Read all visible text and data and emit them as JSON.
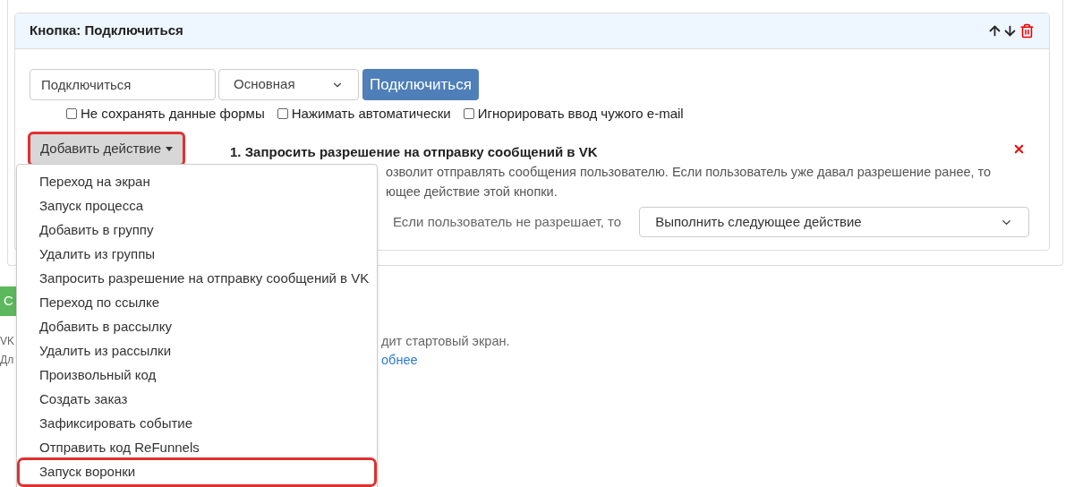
{
  "panel": {
    "title": "Кнопка: Подключиться",
    "button_text_field": {
      "value": "Подключиться"
    },
    "style_select": {
      "value": "Основная"
    },
    "preview_button": "Подключиться",
    "options": [
      {
        "label": "Не сохранять данные формы",
        "checked": false
      },
      {
        "label": "Нажимать автоматически",
        "checked": false
      },
      {
        "label": "Игнорировать ввод чужого e-mail",
        "checked": false
      }
    ],
    "add_action": {
      "label": "Добавить действие",
      "highlighted": true
    },
    "action": {
      "title": "1. Запросить разрешение на отправку сообщений в VK",
      "description_lines": [
        "озволит отправлять сообщения пользователю. Если пользователь уже давал разрешение ранее, то",
        "ющее действие этой кнопки."
      ],
      "deny_label": "Если пользователь не разрешает, то",
      "deny_select": {
        "value": "Выполнить следующее действие"
      }
    }
  },
  "below": {
    "green_button": "С",
    "left_lines": [
      "VK",
      "Дл"
    ],
    "right_text": "дит стартовый экран.",
    "link": "обнее"
  },
  "menu": [
    {
      "label": "Переход на экран",
      "highlighted": false
    },
    {
      "label": "Запуск процесса",
      "highlighted": false
    },
    {
      "label": "Добавить в группу",
      "highlighted": false
    },
    {
      "label": "Удалить из группы",
      "highlighted": false
    },
    {
      "label": "Запросить разрешение на отправку сообщений в VK",
      "highlighted": false
    },
    {
      "label": "Переход по ссылке",
      "highlighted": false
    },
    {
      "label": "Добавить в рассылку",
      "highlighted": false
    },
    {
      "label": "Удалить из рассылки",
      "highlighted": false
    },
    {
      "label": "Произвольный код",
      "highlighted": false
    },
    {
      "label": "Создать заказ",
      "highlighted": false
    },
    {
      "label": "Зафиксировать событие",
      "highlighted": false
    },
    {
      "label": "Отправить код ReFunnels",
      "highlighted": false
    },
    {
      "label": "Запуск воронки",
      "highlighted": true
    }
  ]
}
